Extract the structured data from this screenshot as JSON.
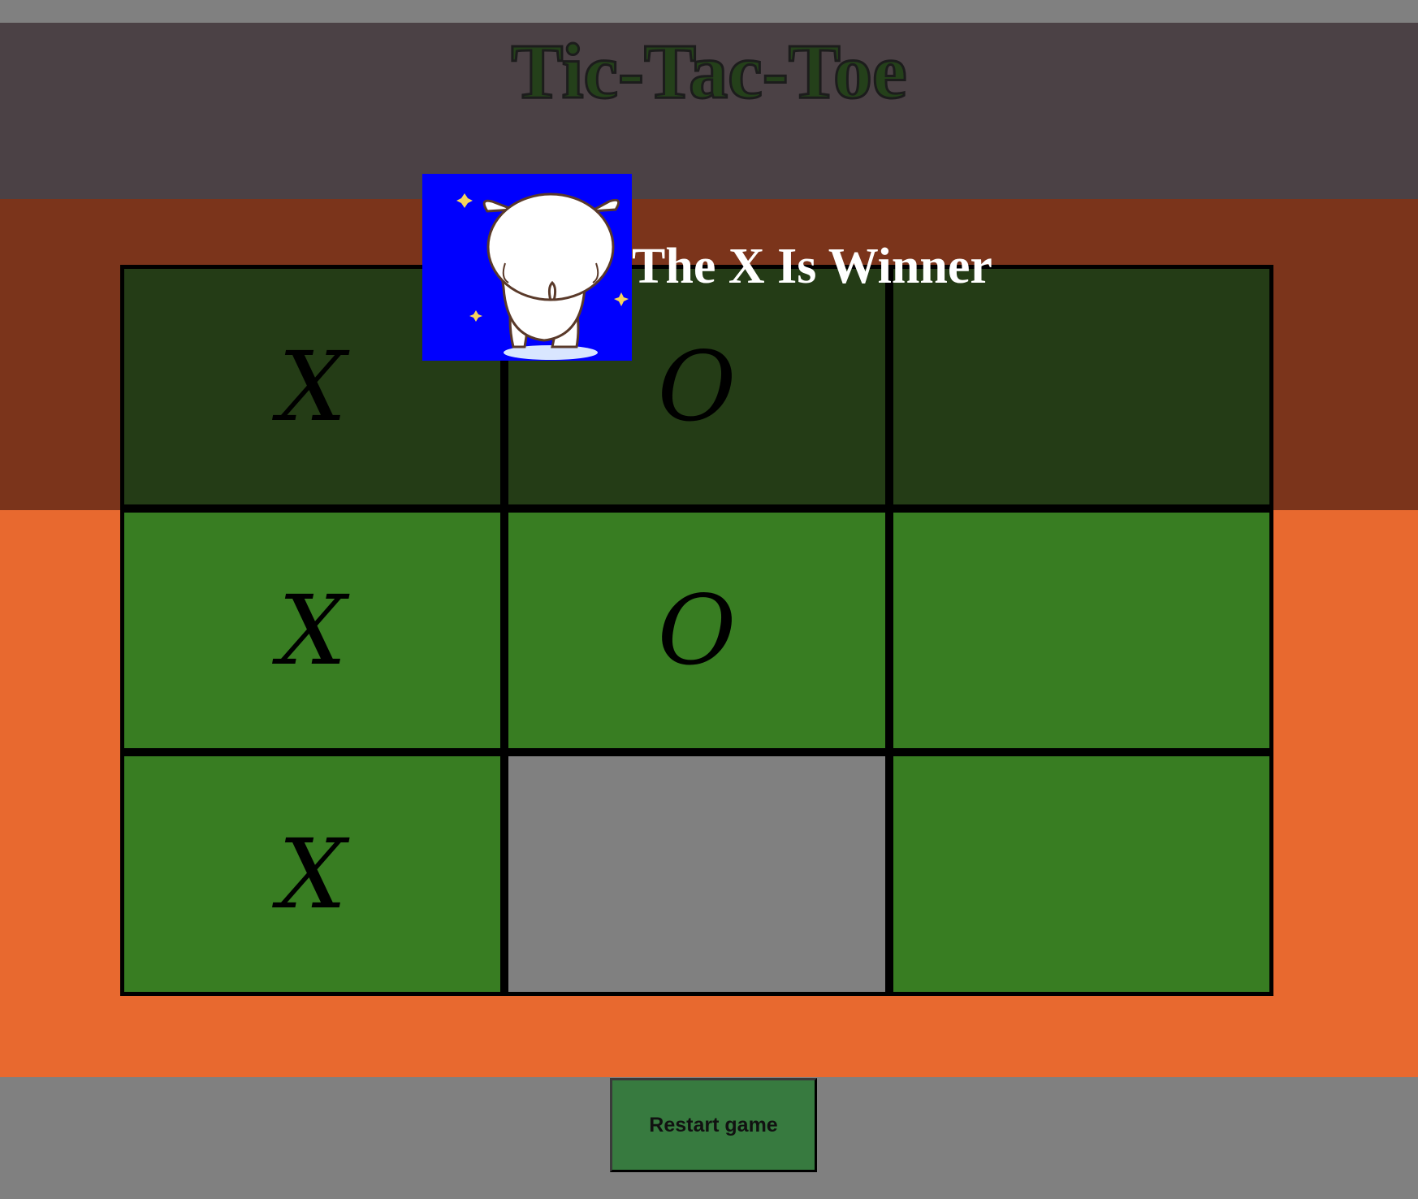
{
  "page": {
    "title": "Tic-Tac-Toe"
  },
  "status": {
    "message": "The X Is Winner",
    "image_icon": "white-cat-cartoon"
  },
  "board": {
    "cells": [
      {
        "value": "X",
        "state": "winning-row-dim"
      },
      {
        "value": "O",
        "state": "winning-row-dim"
      },
      {
        "value": "",
        "state": "winning-row-dim"
      },
      {
        "value": "X",
        "state": "normal"
      },
      {
        "value": "O",
        "state": "normal"
      },
      {
        "value": "",
        "state": "normal"
      },
      {
        "value": "X",
        "state": "normal"
      },
      {
        "value": "",
        "state": "hover"
      },
      {
        "value": "",
        "state": "normal"
      }
    ]
  },
  "controls": {
    "restart_label": "Restart game"
  },
  "colors": {
    "header": "#4b4145",
    "band_top": "#7b341b",
    "band_mid": "#e8692f",
    "cell": "#387d22",
    "cell_dim": "#243c16",
    "cell_hover": "#808080",
    "image_bg": "#0000fe",
    "button": "#377a3f"
  }
}
